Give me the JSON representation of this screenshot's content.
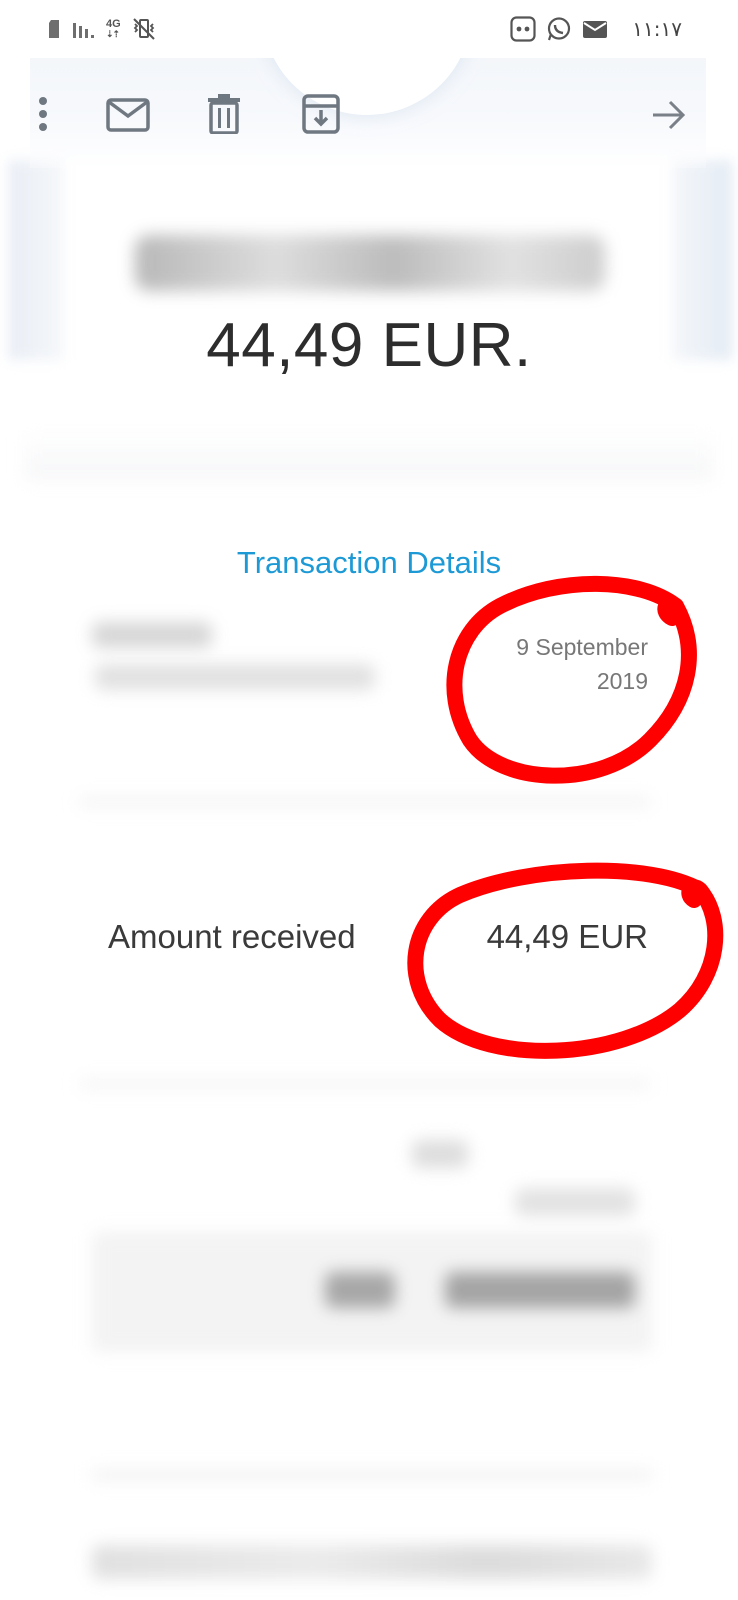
{
  "status_bar": {
    "network": "4G",
    "time": "١١:١٧"
  },
  "toolbar": {
    "icons": [
      "more-vert-icon",
      "mark-unread-icon",
      "delete-icon",
      "archive-icon",
      "forward-arrow-icon"
    ]
  },
  "email": {
    "headline_amount": "44,49 EUR.",
    "section_title": "Transaction Details",
    "date": "9 September 2019",
    "date_line1": "9 September",
    "date_line2": "2019",
    "amount_label": "Amount received",
    "amount_value": "44,49 EUR"
  },
  "annotations": {
    "circle_color": "#ff0000"
  },
  "colors": {
    "link_blue": "#1d9ad6",
    "icon_gray": "#6f7780"
  }
}
